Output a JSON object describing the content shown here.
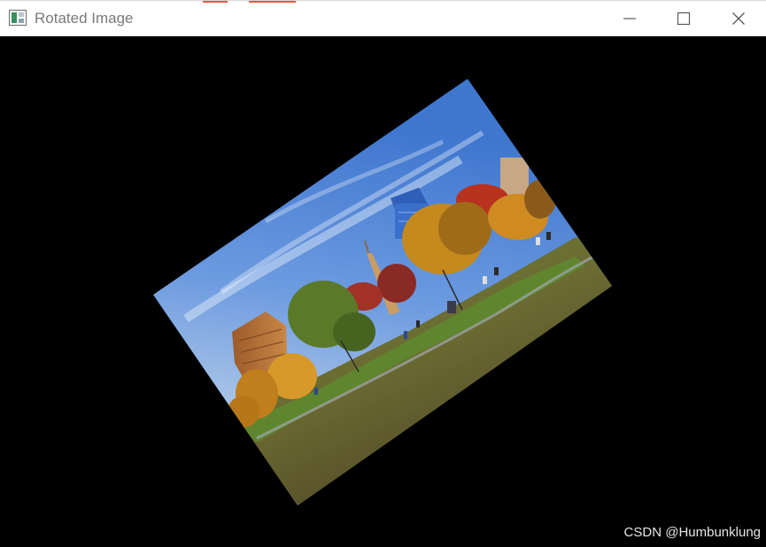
{
  "window": {
    "title": "Rotated Image",
    "buttons": {
      "minimize_icon": "minimize-icon",
      "maximize_icon": "maximize-icon",
      "close_icon": "close-icon"
    }
  },
  "watermark": {
    "text": "CSDN @Humbunklung"
  },
  "colors": {
    "canvas_background": "#000000",
    "titlebar_background": "#ffffff",
    "title_text": "#7a7a7a"
  }
}
